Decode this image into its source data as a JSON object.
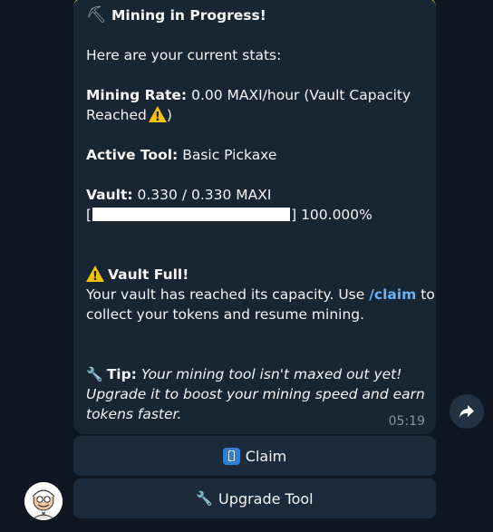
{
  "message": {
    "title": "Mining in Progress!",
    "intro": "Here are your current stats:",
    "mining_rate_label": "Mining Rate:",
    "mining_rate_value": "0.00 MAXI/hour (Vault Capacity",
    "mining_rate_value_cont": "Reached",
    "mining_rate_close": ")",
    "active_tool_label": "Active Tool:",
    "active_tool_value": "Basic Pickaxe",
    "vault_label": "Vault:",
    "vault_value": "0.330 / 0.330 MAXI",
    "progress_open": "[",
    "progress_close": "]",
    "progress_percent_text": "100.000%",
    "progress_fraction": 1.0,
    "vault_full_title": "Vault Full!",
    "vault_full_line1_a": "Your vault has reached its capacity. Use",
    "vault_full_command": "/claim",
    "vault_full_line1_b": "to",
    "vault_full_line2": "collect your tokens and resume mining.",
    "tip_label": "Tip:",
    "tip_line1": "Your mining tool isn't maxed out yet!",
    "tip_line2": "Upgrade it to boost your mining speed and earn",
    "tip_line3": "tokens faster.",
    "time": "05:19"
  },
  "keyboard": {
    "claim_label": "Claim",
    "upgrade_label": "Upgrade Tool"
  },
  "icons": {
    "title_icon": "pickaxe-icon",
    "warning_icon": "warning-icon",
    "tip_icon": "wrench-icon",
    "claim_icon": "mobile-phone-icon",
    "upgrade_icon": "wrench-icon",
    "share_icon": "share-arrow-icon"
  },
  "colors": {
    "background": "#0e1621",
    "bubble": "#182533",
    "link": "#6ab2f2",
    "button": "#1b2b3b"
  }
}
